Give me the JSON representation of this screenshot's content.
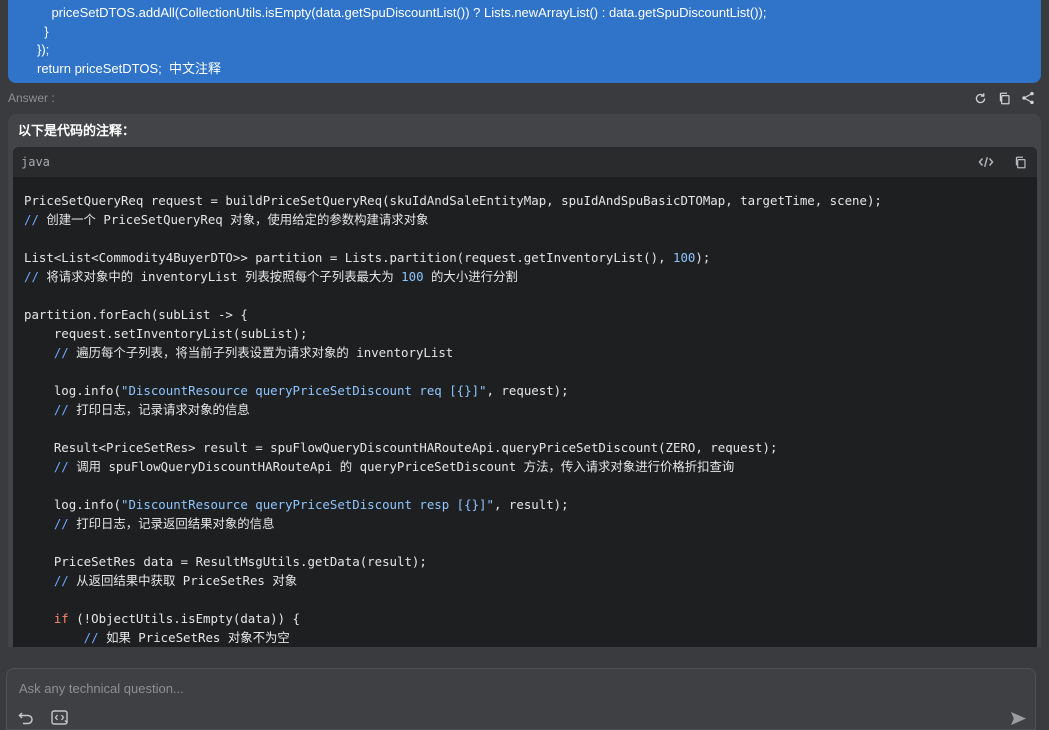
{
  "question": {
    "lines": [
      "    priceSetDTOS.addAll(CollectionUtils.isEmpty(data.getSpuDiscountList()) ? Lists.newArrayList() : data.getSpuDiscountList());",
      "  }",
      "});",
      "return priceSetDTOS;  中文注释"
    ]
  },
  "answer": {
    "label": "Answer :",
    "intro": "以下是代码的注释：",
    "actions": [
      "refresh-icon",
      "copy-icon",
      "share-icon"
    ]
  },
  "code": {
    "language": "java",
    "actions": [
      "code-view-icon",
      "copy-icon"
    ],
    "lines": [
      [
        {
          "t": "PriceSetQueryReq request = buildPriceSetQueryReq(skuIdAndSaleEntityMap, spuIdAndSpuBasicDTOMap, targetTime, scene);",
          "c": ""
        }
      ],
      [
        {
          "t": "// ",
          "c": "comment"
        },
        {
          "t": "创建一个 PriceSetQueryReq 对象，使用给定的参数构建请求对象",
          "c": "comment-text"
        }
      ],
      [],
      [
        {
          "t": "List<List<Commodity4BuyerDTO>> partition = Lists.partition(request.getInventoryList(), ",
          "c": ""
        },
        {
          "t": "100",
          "c": "number"
        },
        {
          "t": ");",
          "c": ""
        }
      ],
      [
        {
          "t": "// ",
          "c": "comment"
        },
        {
          "t": "将请求对象中的 inventoryList 列表按照每个子列表最大为 ",
          "c": "comment-text"
        },
        {
          "t": "100",
          "c": "number"
        },
        {
          "t": " 的大小进行分割",
          "c": "comment-text"
        }
      ],
      [],
      [
        {
          "t": "partition.forEach(subList -> {",
          "c": ""
        }
      ],
      [
        {
          "t": "    request.setInventoryList(subList);",
          "c": ""
        }
      ],
      [
        {
          "t": "    // ",
          "c": "comment"
        },
        {
          "t": "遍历每个子列表，将当前子列表设置为请求对象的 inventoryList",
          "c": "comment-text"
        }
      ],
      [],
      [
        {
          "t": "    log.info(",
          "c": ""
        },
        {
          "t": "\"DiscountResource queryPriceSetDiscount req [{}]\"",
          "c": "string"
        },
        {
          "t": ", request);",
          "c": ""
        }
      ],
      [
        {
          "t": "    // ",
          "c": "comment"
        },
        {
          "t": "打印日志，记录请求对象的信息",
          "c": "comment-text"
        }
      ],
      [],
      [
        {
          "t": "    Result<PriceSetRes> result = spuFlowQueryDiscountHARouteApi.queryPriceSetDiscount(ZERO, request);",
          "c": ""
        }
      ],
      [
        {
          "t": "    // ",
          "c": "comment"
        },
        {
          "t": "调用 spuFlowQueryDiscountHARouteApi 的 queryPriceSetDiscount 方法，传入请求对象进行价格折扣查询",
          "c": "comment-text"
        }
      ],
      [],
      [
        {
          "t": "    log.info(",
          "c": ""
        },
        {
          "t": "\"DiscountResource queryPriceSetDiscount resp [{}]\"",
          "c": "string"
        },
        {
          "t": ", result);",
          "c": ""
        }
      ],
      [
        {
          "t": "    // ",
          "c": "comment"
        },
        {
          "t": "打印日志，记录返回结果对象的信息",
          "c": "comment-text"
        }
      ],
      [],
      [
        {
          "t": "    PriceSetRes data = ResultMsgUtils.getData(result);",
          "c": ""
        }
      ],
      [
        {
          "t": "    // ",
          "c": "comment"
        },
        {
          "t": "从返回结果中获取 PriceSetRes 对象",
          "c": "comment-text"
        }
      ],
      [],
      [
        {
          "t": "    ",
          "c": ""
        },
        {
          "t": "if",
          "c": "keyword"
        },
        {
          "t": " (!ObjectUtils.isEmpty(data)) {",
          "c": ""
        }
      ],
      [
        {
          "t": "        // ",
          "c": "comment"
        },
        {
          "t": "如果 PriceSetRes 对象不为空",
          "c": "comment-text"
        }
      ]
    ]
  },
  "input": {
    "placeholder": "Ask any technical question...",
    "tools": [
      "undo-icon",
      "code-context-icon"
    ],
    "send": "send-icon"
  }
}
